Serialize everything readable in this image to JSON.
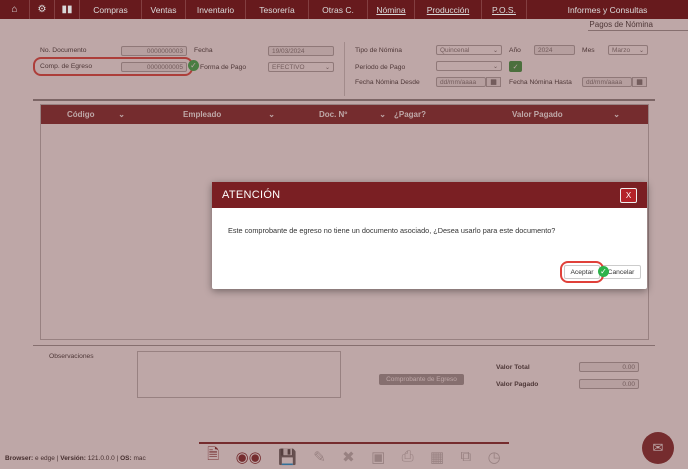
{
  "nav": {
    "icons": [
      "home-icon",
      "gear-icon",
      "bar-chart-icon"
    ],
    "menu": [
      "Compras",
      "Ventas",
      "Inventario",
      "Tesorería",
      "Otras C.",
      "Nómina",
      "Producción",
      "P.O.S.",
      "Informes y Consultas"
    ]
  },
  "page_title": "Pagos de Nómina",
  "form": {
    "no_documento_label": "No. Documento",
    "no_documento_value": "0000000003",
    "comp_egreso_label": "Comp. de Egreso",
    "comp_egreso_value": "0000000005",
    "fecha_label": "Fecha",
    "fecha_value": "19/03/2024",
    "forma_pago_label": "Forma de Pago",
    "forma_pago_value": "EFECTIVO",
    "tipo_nomina_label": "Tipo de Nómina",
    "tipo_nomina_value": "Quincenal",
    "anio_label": "Año",
    "anio_value": "2024",
    "mes_label": "Mes",
    "mes_value": "Marzo",
    "periodo_pago_label": "Período de Pago",
    "periodo_pago_value": "",
    "fecha_desde_label": "Fecha Nómina Desde",
    "fecha_desde_placeholder": "dd/mm/aaaa",
    "fecha_hasta_label": "Fecha Nómina Hasta",
    "fecha_hasta_placeholder": "dd/mm/aaaa"
  },
  "table": {
    "columns": [
      "Código",
      "Empleado",
      "Doc. Nº",
      "¿Pagar?",
      "Valor Pagado"
    ]
  },
  "footer": {
    "observaciones_label": "Observaciones",
    "comprobante_button": "Comprobante de Egreso",
    "valor_total_label": "Valor Total",
    "valor_total_value": "0.00",
    "valor_pagado_label": "Valor Pagado",
    "valor_pagado_value": "0.00"
  },
  "browser_info": {
    "browser_label": "Browser:",
    "browser_value": "edge",
    "version_label": "Versión:",
    "version_value": "121.0.0.0",
    "os_label": "OS:",
    "os_value": "mac"
  },
  "toolbar_icons": [
    "new-document-icon",
    "search-binoculars-icon",
    "save-icon",
    "edit-icon",
    "delete-icon",
    "text-icon",
    "print-icon",
    "excel-icon",
    "copy-icon",
    "history-icon"
  ],
  "modal": {
    "title": "ATENCIÓN",
    "close_label": "X",
    "message": "Este comprobante de egreso no tiene un documento asociado, ¿Desea usarlo para este documento?",
    "accept_label": "Aceptar",
    "cancel_label": "Cancelar"
  },
  "colors": {
    "brand": "#7a1f23",
    "highlight": "#e0413a",
    "check": "#2db34a"
  }
}
